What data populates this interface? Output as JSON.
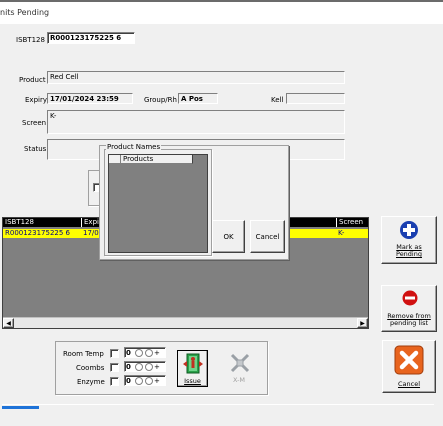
{
  "window": {
    "title": "nits Pending"
  },
  "form": {
    "isbt_label": "ISBT128",
    "isbt_value": "R000123175225 6",
    "product_label": "Product",
    "product_value": "Red Cell",
    "expiry_label": "Expiry",
    "expiry_value": "17/01/2024 23:59",
    "group_label": "Group/Rh",
    "group_value": "A Pos",
    "kell_label": "Kell",
    "kell_value": "",
    "screen_label": "Screen",
    "screen_value": "K-",
    "status_label": "Status",
    "status_value": ""
  },
  "dialog": {
    "group_title": "Product Names",
    "list_header": "Products",
    "ok_label": "OK",
    "cancel_label": "Cancel"
  },
  "grid": {
    "headers": {
      "isbt": "ISBT128",
      "expiry": "Expir",
      "screen": "Screen"
    },
    "row": {
      "isbt": "R000123175225 6",
      "expiry": "17/0",
      "screen": "K-"
    }
  },
  "buttons": {
    "mark_pending": [
      "Mark as",
      "Pending"
    ],
    "remove_pending": [
      "Remove from",
      "pending list"
    ],
    "cancel": "Cancel",
    "issue": "Issue",
    "xm": "X-M"
  },
  "tests": {
    "room_temp": "Room Temp",
    "coombs": "Coombs",
    "enzyme": "Enzyme",
    "spin_value": "0"
  },
  "colors": {
    "grid_row": "#ffff00",
    "grid_text": "#000080",
    "mark_icon": "#1a3fb0",
    "remove_icon": "#d01010",
    "cancel_icon": "#e8641e",
    "progress": "#1e73d8"
  }
}
